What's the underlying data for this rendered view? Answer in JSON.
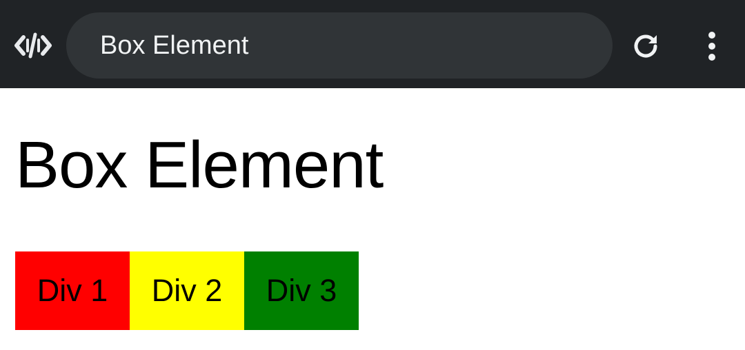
{
  "browser": {
    "address_title": "Box Element",
    "logo_icon": "code-brackets-icon",
    "reload_icon": "reload-icon",
    "menu_icon": "more-vertical-icon",
    "toolbar_color": "#202326",
    "address_bar_color": "#303437"
  },
  "page": {
    "heading": "Box Element",
    "boxes": [
      {
        "label": "Div 1",
        "color": "#ff0000"
      },
      {
        "label": "Div 2",
        "color": "#ffff00"
      },
      {
        "label": "Div 3",
        "color": "#008000"
      }
    ]
  }
}
